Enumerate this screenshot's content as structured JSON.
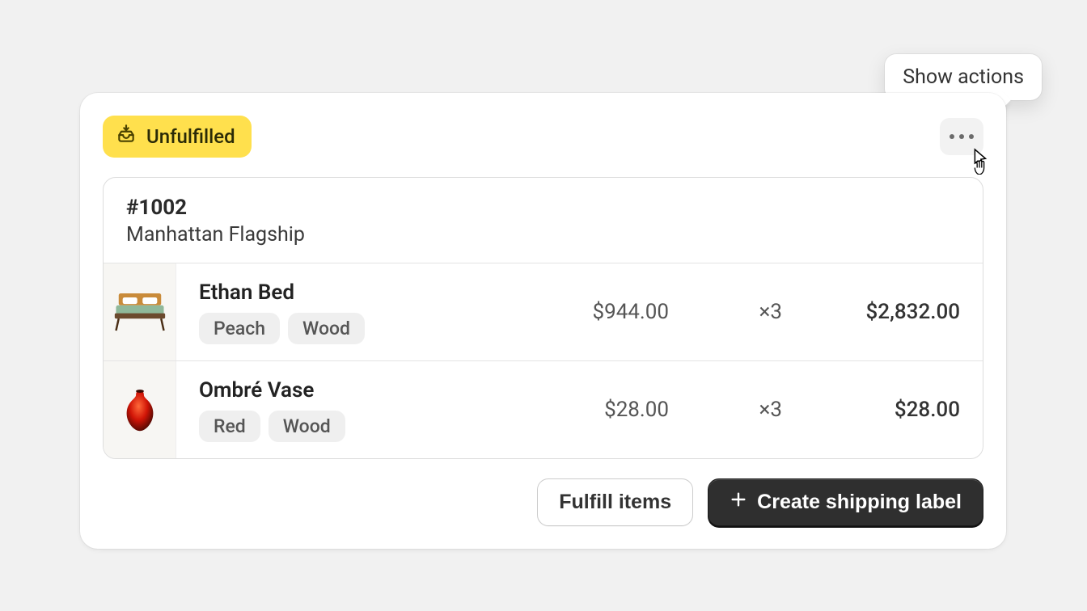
{
  "tooltip": {
    "label": "Show actions"
  },
  "status": {
    "label": "Unfulfilled"
  },
  "order": {
    "number": "#1002",
    "location": "Manhattan Flagship"
  },
  "items": [
    {
      "title": "Ethan Bed",
      "variants": [
        "Peach",
        "Wood"
      ],
      "unit_price": "$944.00",
      "qty": "×3",
      "total": "$2,832.00",
      "thumb": "bed"
    },
    {
      "title": "Ombré Vase",
      "variants": [
        "Red",
        "Wood"
      ],
      "unit_price": "$28.00",
      "qty": "×3",
      "total": "$28.00",
      "thumb": "vase"
    }
  ],
  "actions": {
    "fulfill": "Fulfill items",
    "create_label": "Create shipping label"
  }
}
